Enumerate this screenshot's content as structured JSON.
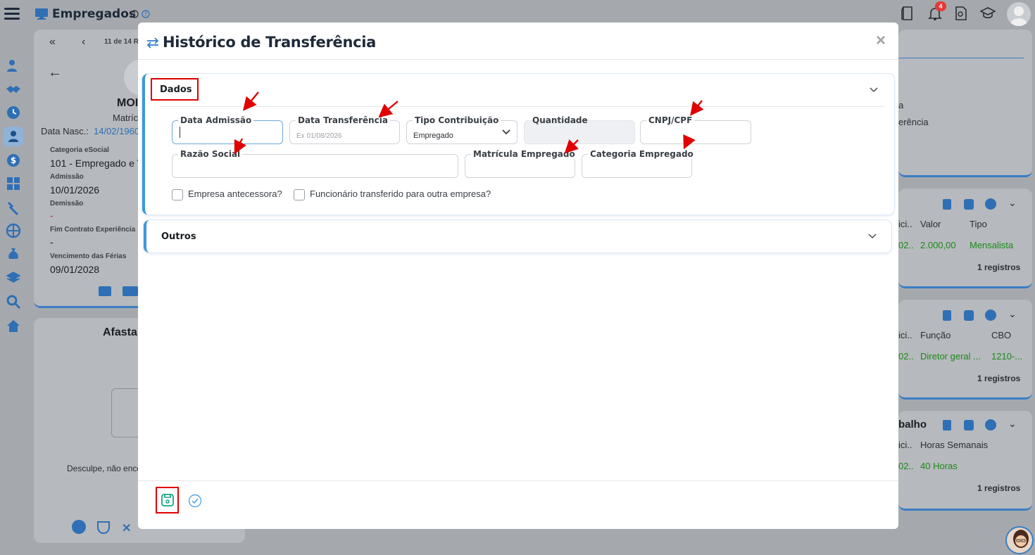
{
  "app": {
    "page_title": "Empregados",
    "notification_count": "4"
  },
  "profile_card": {
    "pager": "11 de 14 R",
    "name_partial": "MOI",
    "matricula_partial": "Matríc",
    "birth_label": "Data Nasc.:",
    "birth_value": "14/02/1960",
    "fields": [
      {
        "label": "Categoria eSocial",
        "value": "101 - Empregado e T"
      },
      {
        "label": "Admissão",
        "value": "10/01/2026"
      },
      {
        "label": "Demissão",
        "value": "-"
      },
      {
        "label": "Fim Contrato Experiência",
        "value": "-"
      },
      {
        "label": "Vencimento das Férias",
        "value": "09/01/2028"
      }
    ]
  },
  "afastamento_card": {
    "title_partial": "Afasta",
    "empty_text": "Desculpe, não enco"
  },
  "right_cards": {
    "top_partial": [
      "a",
      "erência"
    ],
    "salary": {
      "headers": [
        "ici..",
        "Valor",
        "Tipo"
      ],
      "row": [
        "02..",
        "2.000,00",
        "Mensalista"
      ],
      "footer": "1 registros"
    },
    "funcao": {
      "headers": [
        "ici..",
        "Função",
        "CBO"
      ],
      "row": [
        "02..",
        "Diretor geral ...",
        "1210-..."
      ],
      "footer": "1 registros"
    },
    "jornada": {
      "title_partial": "balho",
      "headers": [
        "ici..",
        "Horas Semanais"
      ],
      "row": [
        "02..",
        "40 Horas"
      ],
      "footer": "1 registros"
    }
  },
  "modal": {
    "title": "Histórico de Transferência",
    "close_glyph": "×",
    "sections": {
      "dados": {
        "title": "Dados",
        "fields": {
          "data_admissao": {
            "label": "Data Admissão",
            "value": ""
          },
          "data_transferencia": {
            "label": "Data Transferência",
            "placeholder": "Ex 01/08/2026"
          },
          "tipo_contribuicao": {
            "label": "Tipo Contribuição",
            "value": "Empregado"
          },
          "quantidade": {
            "label": "Quantidade",
            "value": ""
          },
          "cnpj_cpf": {
            "label": "CNPJ/CPF",
            "value": ""
          },
          "razao_social": {
            "label": "Razão Social",
            "value": ""
          },
          "matricula_empregado": {
            "label": "Matrícula Empregado",
            "value": ""
          },
          "categoria_empregado": {
            "label": "Categoria Empregado",
            "value": ""
          }
        },
        "checkboxes": {
          "empresa_antecessora": {
            "label": "Empresa antecessora?",
            "checked": false
          },
          "funcionario_transferido": {
            "label": "Funcionário transferido para outra empresa?",
            "checked": false
          }
        }
      },
      "outros": {
        "title": "Outros"
      }
    }
  },
  "colors": {
    "accent": "#3f97dc",
    "overlay": "#a5a9ae",
    "annotation_red": "#e00000",
    "save_green": "#1aa386",
    "badge_red": "#e53935"
  }
}
